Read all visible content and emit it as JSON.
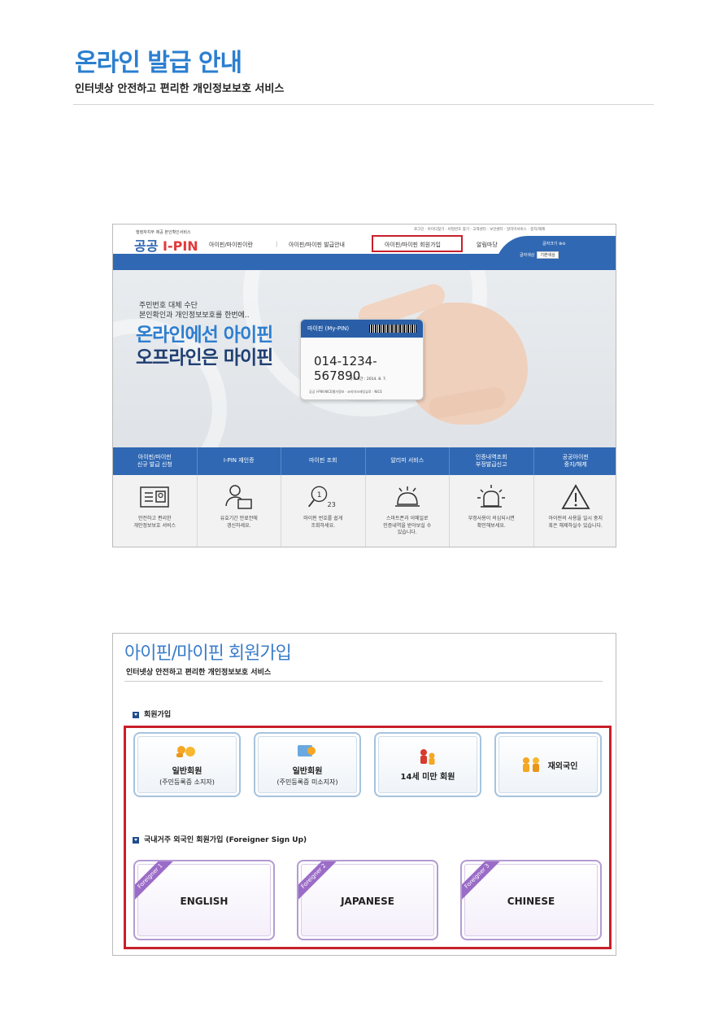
{
  "header": {
    "title": "온라인 발급 안내",
    "subtitle": "인터넷상 안전하고 편리한 개인정보보호 서비스"
  },
  "shot1": {
    "logo_small": "행정자치부 제공 본인확인서비스",
    "logo_prefix": "공공",
    "logo_main": "I-PIN",
    "top_links": "로그인 · 아이디찾기 · 비밀번호 찾기 · 고객센터 · 보안센터 · 알리미서비스 · 중지/해제",
    "nav": [
      "아이핀/마이핀이란",
      "아이핀/마이핀 발급안내",
      "아이핀/마이핀 회원가입",
      "알림마당"
    ],
    "font_size_label": "글자크기",
    "font_color_label": "글자색상",
    "font_color_value": "기본색상",
    "hero_line1": "주민번호 대체 수단",
    "hero_line2": "본인확인과 개인정보보호를 한번에..",
    "hero_big1": "온라인에선 아이핀",
    "hero_big2": "오프라인은 마이핀",
    "card_title": "마이핀 (My-PIN)",
    "card_number": "014-1234-567890",
    "card_date": "유효기간 : 2014. 8. 7.",
    "card_footer": "공공 I-PIN  NICE평가정보 · 코리아크레딧뷰로 · NICE",
    "menu": [
      "아이핀/마이핀\n신규 발급 신청",
      "I-PIN 재인증",
      "마이핀 조회",
      "알리미 서비스",
      "인증내역조회\n부정발급신고",
      "공공아이핀\n중지/해제"
    ],
    "cells": [
      "안전하고 편리한\n개인정보보호 서비스",
      "유효기간 만료전에\n갱신하세요.",
      "마이핀 번호를 쉽게\n조회하세요.",
      "스마트폰과 이메일로\n인증내역을 받아보실 수\n있습니다.",
      "부정사용이 의심되시면\n확인해보세요.",
      "아이핀의 사용을 일시 중지\n혹은 해제하실수 있습니다."
    ],
    "cell_icon_text": "23"
  },
  "shot2": {
    "title": "아이핀/마이핀 회원가입",
    "subtitle": "인터넷상 안전하고 편리한 개인정보보호 서비스",
    "section1": "회원가입",
    "members": [
      {
        "line1": "일반회원",
        "line2": "(주민등록증 소지자)"
      },
      {
        "line1": "일반회원",
        "line2": "(주민등록증 미소지자)"
      },
      {
        "line1": "14세 미만 회원",
        "line2": ""
      },
      {
        "line1": "재외국인",
        "line2": ""
      }
    ],
    "section2": "국내거주 외국인 회원가입 (Foreigner Sign Up)",
    "foreigners": [
      {
        "ribbon": "Foreigner 1",
        "label": "ENGLISH"
      },
      {
        "ribbon": "Foreigner 2",
        "label": "JAPANESE"
      },
      {
        "ribbon": "Foreigner 3",
        "label": "CHINESE"
      }
    ]
  }
}
